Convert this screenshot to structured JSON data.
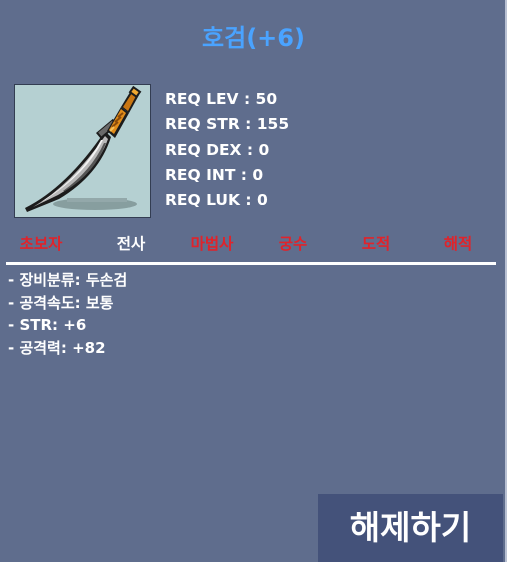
{
  "item": {
    "name": "호검(+6)",
    "icon": "curved-sword-icon"
  },
  "requirements": [
    "REQ LEV : 50",
    "REQ STR : 155",
    "REQ DEX : 0",
    "REQ INT : 0",
    "REQ LUK : 0"
  ],
  "jobs": [
    {
      "label": "초보자",
      "allowed": false
    },
    {
      "label": "전사",
      "allowed": true
    },
    {
      "label": "마법사",
      "allowed": false
    },
    {
      "label": "궁수",
      "allowed": false
    },
    {
      "label": "도적",
      "allowed": false
    },
    {
      "label": "해적",
      "allowed": false
    }
  ],
  "stats": [
    "- 장비분류: 두손검",
    "- 공격속도: 보통",
    "- STR: +6",
    "- 공격력: +82"
  ],
  "actions": {
    "unequip_label": "해제하기"
  },
  "colors": {
    "panel": "#5f6d8d",
    "title": "#4aa3ff",
    "job_allowed": "#ffffff",
    "job_denied": "#e0232b",
    "button": "#44527a",
    "icon_background": "#b5d0d2"
  }
}
